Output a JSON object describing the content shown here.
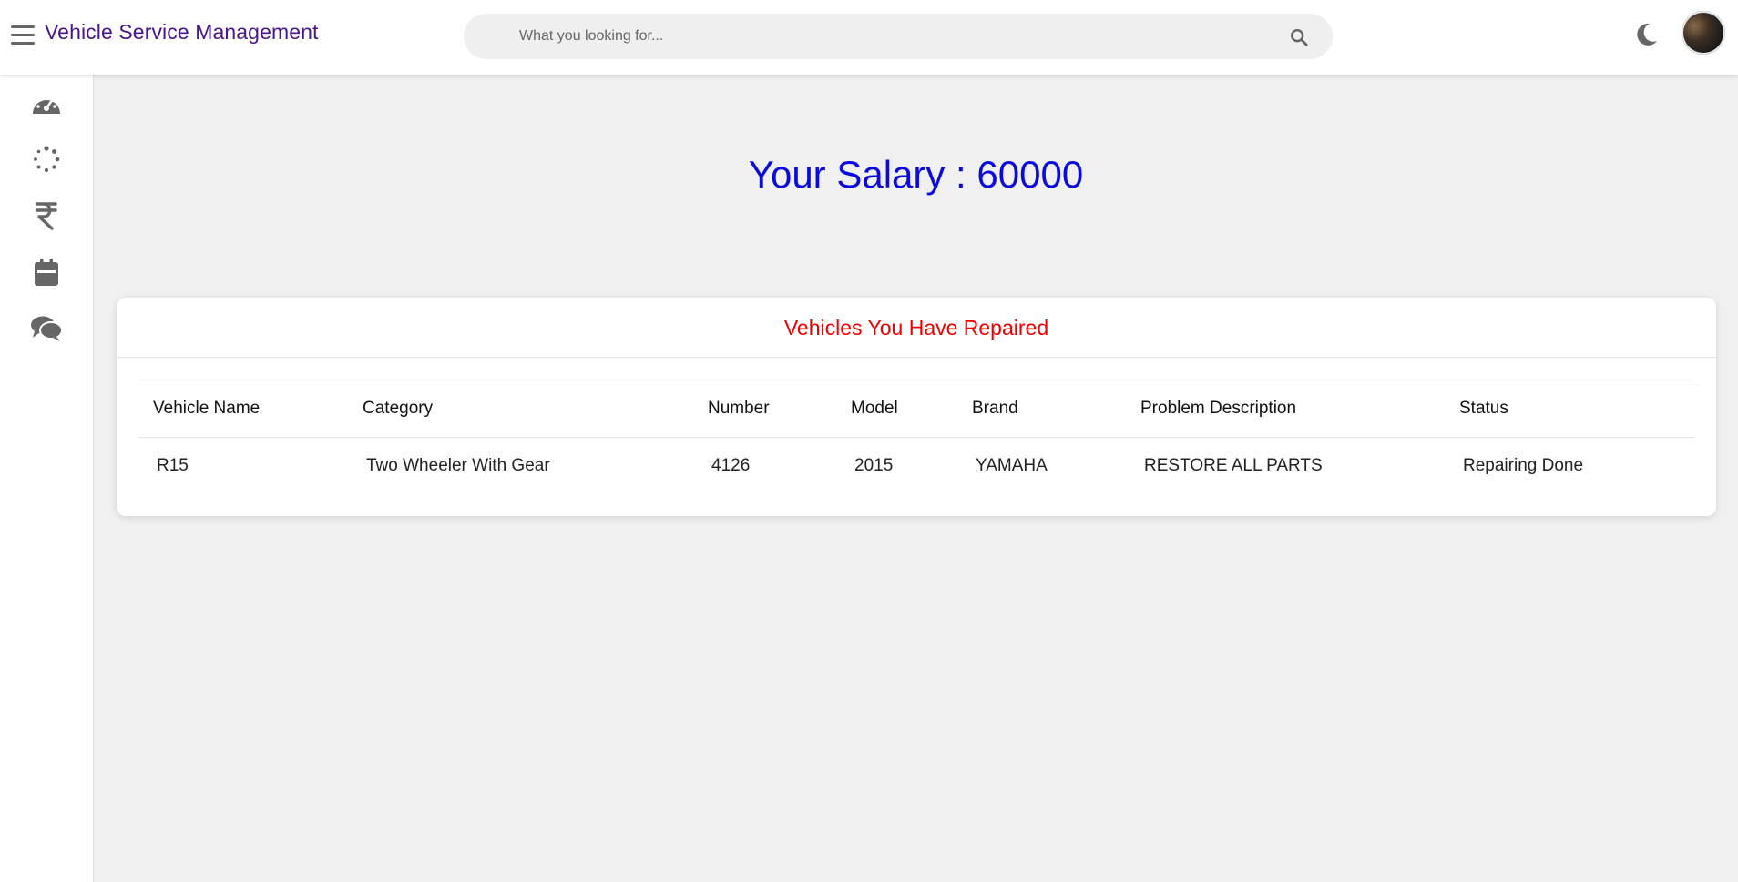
{
  "header": {
    "title": "Vehicle Service Management",
    "search_placeholder": "What you looking for..."
  },
  "sidebar": {
    "items": [
      {
        "icon": "dashboard-gauge-icon"
      },
      {
        "icon": "loading-spinner-icon"
      },
      {
        "icon": "rupee-icon"
      },
      {
        "icon": "calendar-icon"
      },
      {
        "icon": "chat-bubbles-icon"
      }
    ]
  },
  "main": {
    "salary_text": "Your Salary : 60000",
    "card_title": "Vehicles You Have Repaired",
    "table": {
      "headers": [
        "Vehicle Name",
        "Category",
        "Number",
        "Model",
        "Brand",
        "Problem Description",
        "Status"
      ],
      "rows": [
        [
          "R15",
          "Two Wheeler With Gear",
          "4126",
          "2015",
          "YAMAHA",
          "RESTORE ALL PARTS",
          "Repairing Done"
        ]
      ]
    }
  },
  "colors": {
    "title": "#4a148c",
    "salary": "#0a0adf",
    "card_title": "#ef0000",
    "icon": "#666666"
  }
}
